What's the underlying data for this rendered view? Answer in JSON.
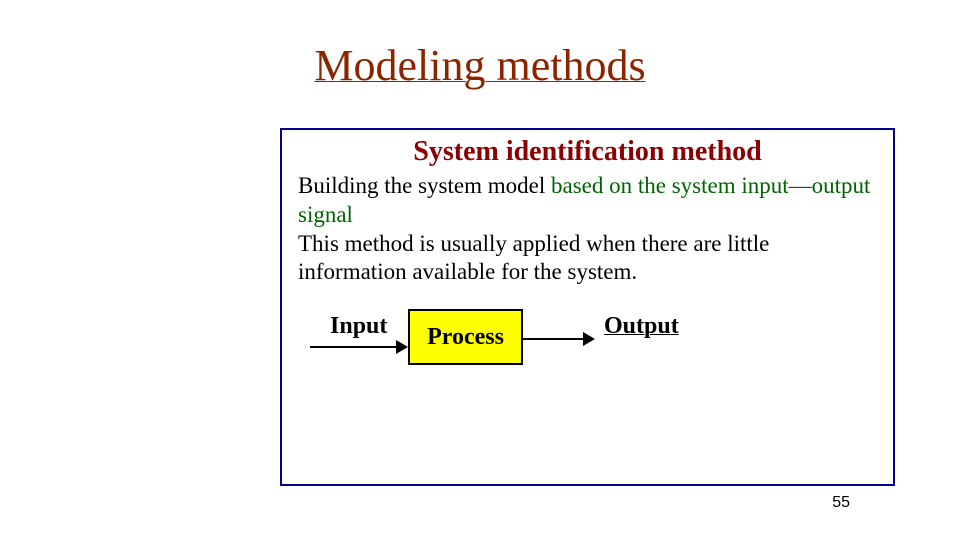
{
  "title": "Modeling methods",
  "box": {
    "subtitle": "System identification method",
    "line1_black": "Building the system model ",
    "line1_green": "based on the system input—output signal",
    "line2": "This method is usually applied when there are little information available for the system."
  },
  "diagram": {
    "input": "Input",
    "process": "Process",
    "output": "Output"
  },
  "page": "55"
}
